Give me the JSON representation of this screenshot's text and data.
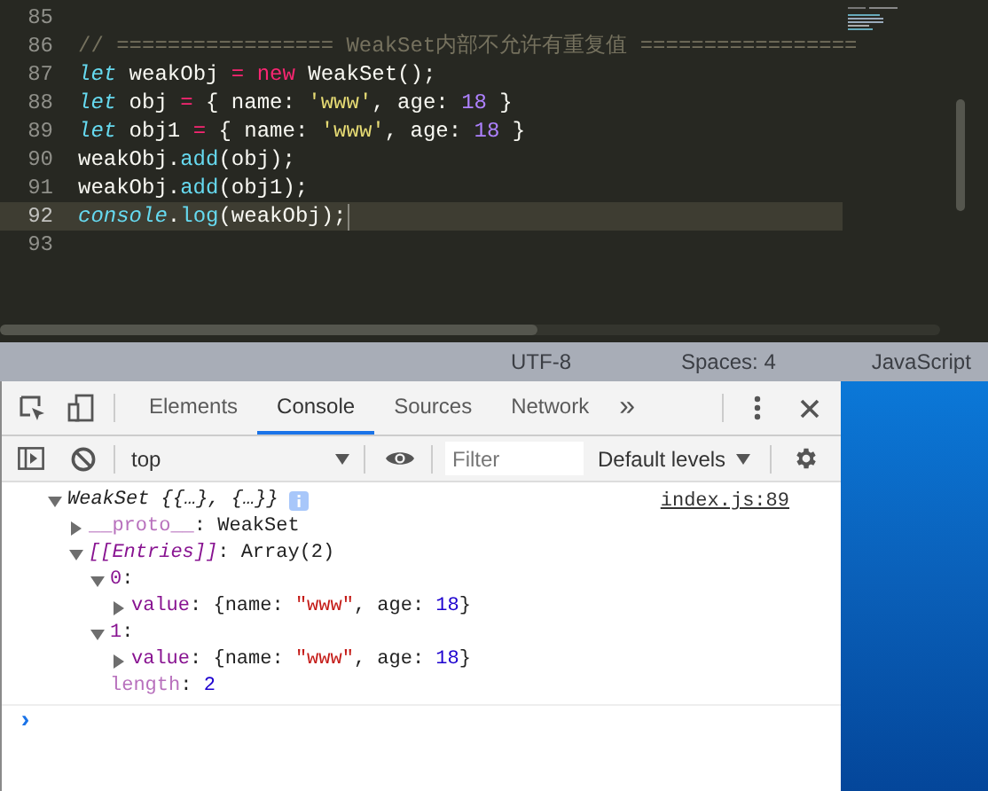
{
  "editor": {
    "lines": [
      {
        "number": "85",
        "current": false
      },
      {
        "number": "86",
        "current": false,
        "tokens": [
          {
            "kind": "comment",
            "text": "// ================= WeakSet内部不允许有重复值 ================="
          }
        ]
      },
      {
        "number": "87",
        "current": false,
        "tokens": [
          {
            "kind": "storage",
            "text": "let"
          },
          {
            "kind": "plain",
            "text": " weakObj "
          },
          {
            "kind": "operator",
            "text": "= "
          },
          {
            "kind": "operator",
            "text": "new"
          },
          {
            "kind": "plain",
            "text": " WeakSet();"
          }
        ]
      },
      {
        "number": "88",
        "current": false,
        "tokens": [
          {
            "kind": "storage",
            "text": "let"
          },
          {
            "kind": "plain",
            "text": " obj "
          },
          {
            "kind": "operator",
            "text": "="
          },
          {
            "kind": "plain",
            "text": " { name: "
          },
          {
            "kind": "string",
            "text": "'www'"
          },
          {
            "kind": "plain",
            "text": ", age: "
          },
          {
            "kind": "number",
            "text": "18"
          },
          {
            "kind": "plain",
            "text": " }"
          }
        ]
      },
      {
        "number": "89",
        "current": false,
        "tokens": [
          {
            "kind": "storage",
            "text": "let"
          },
          {
            "kind": "plain",
            "text": " obj1 "
          },
          {
            "kind": "operator",
            "text": "="
          },
          {
            "kind": "plain",
            "text": " { name: "
          },
          {
            "kind": "string",
            "text": "'www'"
          },
          {
            "kind": "plain",
            "text": ", age: "
          },
          {
            "kind": "number",
            "text": "18"
          },
          {
            "kind": "plain",
            "text": " }"
          }
        ]
      },
      {
        "number": "90",
        "current": false,
        "tokens": [
          {
            "kind": "plain",
            "text": "weakObj."
          },
          {
            "kind": "function",
            "text": "add"
          },
          {
            "kind": "plain",
            "text": "(obj);"
          }
        ]
      },
      {
        "number": "91",
        "current": false,
        "tokens": [
          {
            "kind": "plain",
            "text": "weakObj."
          },
          {
            "kind": "function",
            "text": "add"
          },
          {
            "kind": "plain",
            "text": "(obj1);"
          }
        ]
      },
      {
        "number": "92",
        "current": true,
        "tokens": [
          {
            "kind": "storage",
            "text": "console"
          },
          {
            "kind": "plain",
            "text": "."
          },
          {
            "kind": "function",
            "text": "log"
          },
          {
            "kind": "plain",
            "text": "(weakObj);"
          }
        ]
      },
      {
        "number": "93",
        "current": false
      }
    ]
  },
  "status_bar": {
    "items": [
      "UTF-8",
      "Spaces: 4",
      "JavaScript"
    ]
  },
  "devtools": {
    "tabs": [
      {
        "label": "Elements",
        "selected": false
      },
      {
        "label": "Console",
        "selected": true
      },
      {
        "label": "Sources",
        "selected": false
      },
      {
        "label": "Network",
        "selected": false
      }
    ],
    "more_tabs": "»",
    "context": "top",
    "filter": {
      "placeholder": "Filter"
    },
    "levels": "Default levels",
    "message": {
      "source": "index.js:89",
      "tree": [
        {
          "expanded": true,
          "info": true,
          "tokens": [
            {
              "kind": "preview",
              "text": "WeakSet {{…}, {…}}"
            }
          ],
          "children": [
            {
              "expanded": false,
              "tokens": [
                {
                  "kind": "dim-key",
                  "text": "__proto__"
                },
                {
                  "kind": "plain",
                  "text": ": WeakSet"
                }
              ]
            },
            {
              "expanded": true,
              "tokens": [
                {
                  "kind": "internal-key",
                  "text": "[[Entries]]"
                },
                {
                  "kind": "plain",
                  "text": ": Array(2)"
                }
              ],
              "children": [
                {
                  "expanded": true,
                  "tokens": [
                    {
                      "kind": "key",
                      "text": "0"
                    },
                    {
                      "kind": "plain",
                      "text": ":"
                    }
                  ],
                  "children": [
                    {
                      "expanded": false,
                      "tokens": [
                        {
                          "kind": "key",
                          "text": "value"
                        },
                        {
                          "kind": "plain",
                          "text": ": {name: "
                        },
                        {
                          "kind": "string",
                          "text": "\"www\""
                        },
                        {
                          "kind": "plain",
                          "text": ", age: "
                        },
                        {
                          "kind": "number",
                          "text": "18"
                        },
                        {
                          "kind": "plain",
                          "text": "}"
                        }
                      ]
                    }
                  ]
                },
                {
                  "expanded": true,
                  "tokens": [
                    {
                      "kind": "key",
                      "text": "1"
                    },
                    {
                      "kind": "plain",
                      "text": ":"
                    }
                  ],
                  "children": [
                    {
                      "expanded": false,
                      "tokens": [
                        {
                          "kind": "key",
                          "text": "value"
                        },
                        {
                          "kind": "plain",
                          "text": ": {name: "
                        },
                        {
                          "kind": "string",
                          "text": "\"www\""
                        },
                        {
                          "kind": "plain",
                          "text": ", age: "
                        },
                        {
                          "kind": "number",
                          "text": "18"
                        },
                        {
                          "kind": "plain",
                          "text": "}"
                        }
                      ]
                    }
                  ]
                },
                {
                  "tokens": [
                    {
                      "kind": "dim-key",
                      "text": "length"
                    },
                    {
                      "kind": "plain",
                      "text": ": "
                    },
                    {
                      "kind": "number",
                      "text": "2"
                    }
                  ]
                }
              ]
            }
          ]
        }
      ]
    },
    "prompt": "›"
  }
}
